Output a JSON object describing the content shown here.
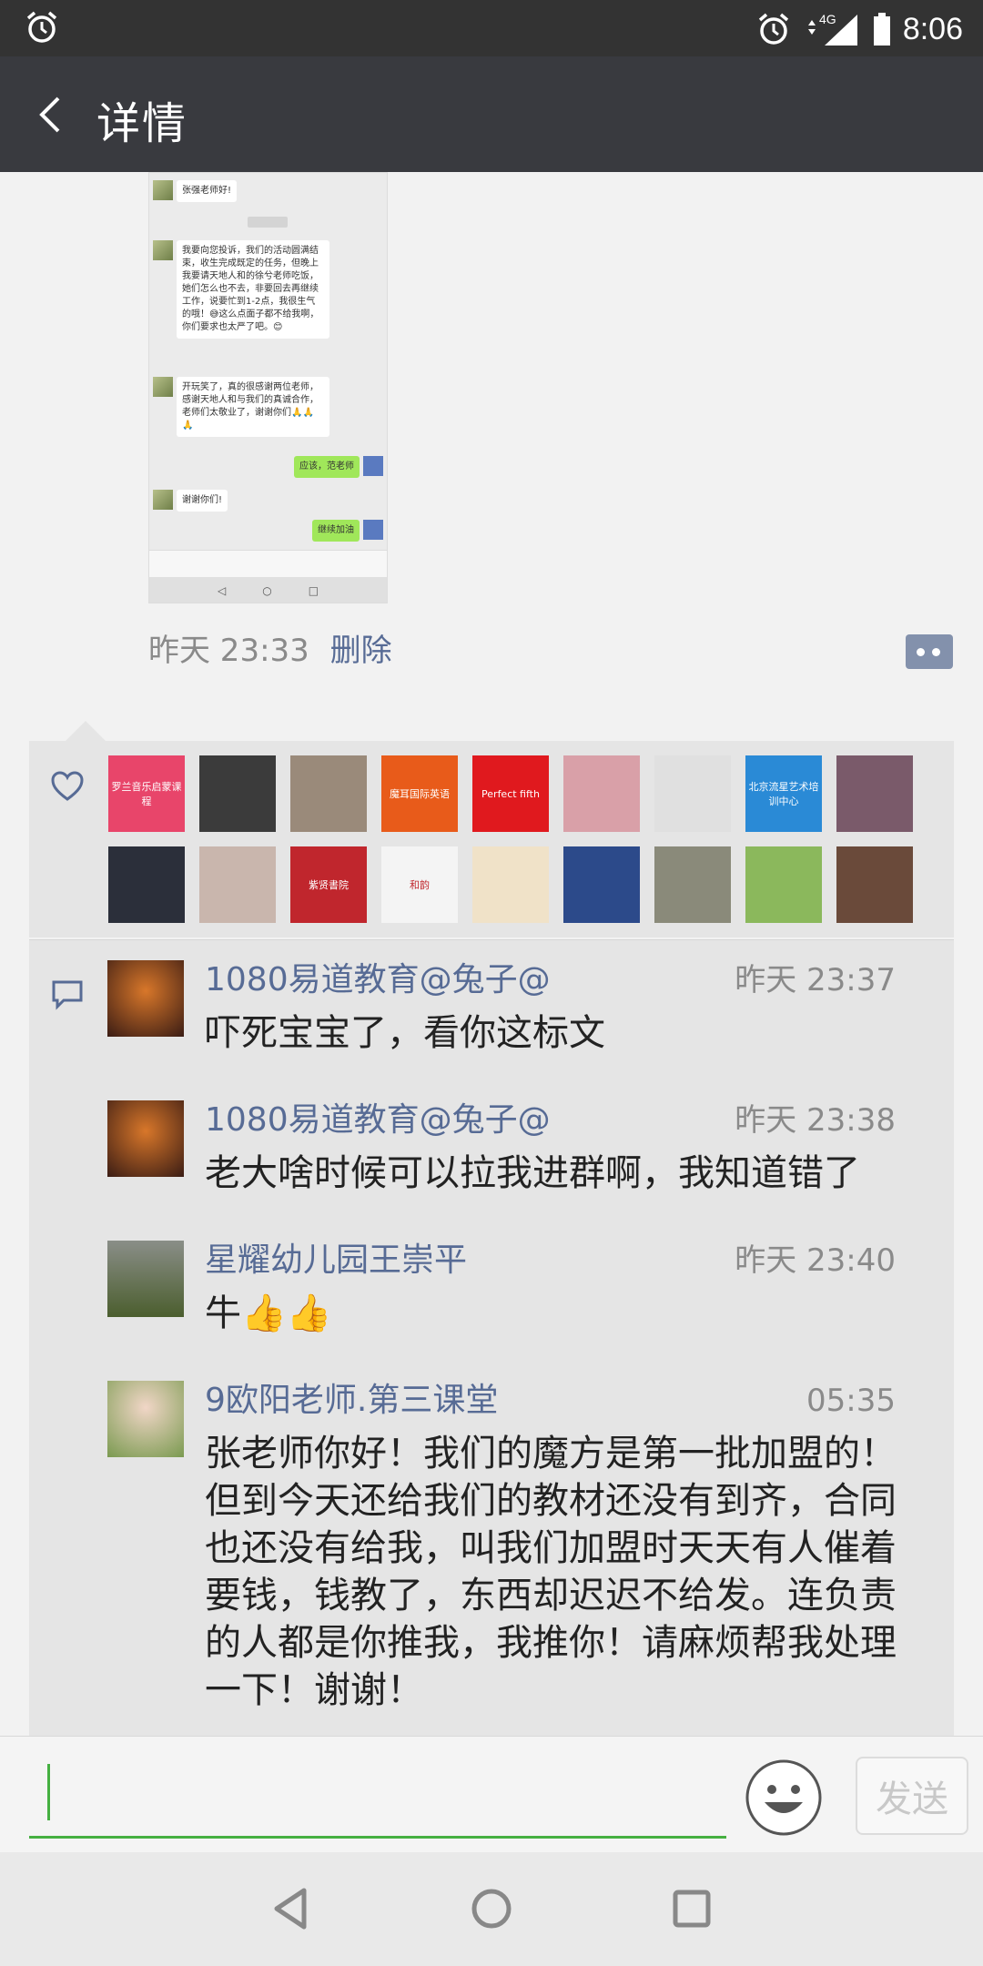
{
  "status": {
    "time": "8:06",
    "network": "4G"
  },
  "nav": {
    "title": "详情"
  },
  "screenshot": {
    "messages": [
      {
        "side": "left",
        "text": "张强老师好!"
      },
      {
        "side": "left",
        "text": "我要向您投诉，我们的活动圆满结束，收生完成既定的任务，但晚上我要请天地人和的徐兮老师吃饭，她们怎么也不去，非要回去再继续工作，说要忙到1-2点，我很生气的哦！😅这么点面子都不给我啊，你们要求也太严了吧。😊"
      },
      {
        "side": "left",
        "text": "开玩笑了，真的很感谢两位老师，感谢天地人和与我们的真诚合作，老师们太敬业了，谢谢你们🙏🙏🙏"
      },
      {
        "side": "right",
        "text": "应该，范老师"
      },
      {
        "side": "left",
        "text": "谢谢你们!"
      },
      {
        "side": "right",
        "text": "继续加油"
      }
    ],
    "nav_glyphs": [
      "◁",
      "○",
      "□"
    ]
  },
  "post": {
    "time": "昨天 23:33",
    "delete_label": "删除"
  },
  "likes": {
    "avatars": [
      {
        "name": "likeavatar-1",
        "label": "罗兰音乐启蒙课程",
        "color": "#e8456a"
      },
      {
        "name": "likeavatar-2",
        "label": "",
        "color": "#3b3b3b"
      },
      {
        "name": "likeavatar-3",
        "label": "",
        "color": "#9a8a7a"
      },
      {
        "name": "likeavatar-4",
        "label": "魔耳国际英语",
        "color": "#e85b1a"
      },
      {
        "name": "likeavatar-5",
        "label": "Perfect fifth",
        "color": "#e0191e"
      },
      {
        "name": "likeavatar-6",
        "label": "",
        "color": "#d9a0a8"
      },
      {
        "name": "likeavatar-7",
        "label": "",
        "color": "#e0e0e0"
      },
      {
        "name": "likeavatar-8",
        "label": "北京流星艺术培训中心",
        "color": "#2a8ad6"
      },
      {
        "name": "likeavatar-9",
        "label": "",
        "color": "#7a5a6a"
      },
      {
        "name": "likeavatar-10",
        "label": "",
        "color": "#2b2f3a"
      },
      {
        "name": "likeavatar-11",
        "label": "",
        "color": "#c9b6ad"
      },
      {
        "name": "likeavatar-12",
        "label": "紫贤書院",
        "color": "#c0262d"
      },
      {
        "name": "likeavatar-13",
        "label": "和韵",
        "color": "#f4f4f4"
      },
      {
        "name": "likeavatar-14",
        "label": "",
        "color": "#f0e2c8"
      },
      {
        "name": "likeavatar-15",
        "label": "",
        "color": "#2c4a8a"
      },
      {
        "name": "likeavatar-16",
        "label": "",
        "color": "#8a8a7a"
      },
      {
        "name": "likeavatar-17",
        "label": "",
        "color": "#8bb85c"
      },
      {
        "name": "likeavatar-18",
        "label": "",
        "color": "#6a4a3a"
      }
    ]
  },
  "comments": [
    {
      "name": "1080易道教育@兔子@",
      "time": "昨天 23:37",
      "text": "吓死宝宝了，看你这标文"
    },
    {
      "name": "1080易道教育@兔子@",
      "time": "昨天 23:38",
      "text": "老大啥时候可以拉我进群啊，我知道错了"
    },
    {
      "name": "星耀幼儿园王崇平",
      "time": "昨天 23:40",
      "text": "牛👍👍"
    },
    {
      "name": "9欧阳老师.第三课堂",
      "time": "05:35",
      "text": "张老师你好！我们的魔方是第一批加盟的！但到今天还给我们的教材还没有到齐，合同也还没有给我，叫我们加盟时天天有人催着要钱，钱教了，东西却迟迟不给发。连负责的人都是你推我，我推你！请麻烦帮我处理一下！谢谢！"
    }
  ],
  "input": {
    "placeholder": "",
    "send_label": "发送"
  },
  "colors": {
    "accent": "#45b041",
    "link": "#576b95",
    "navbar": "#393a3f"
  }
}
